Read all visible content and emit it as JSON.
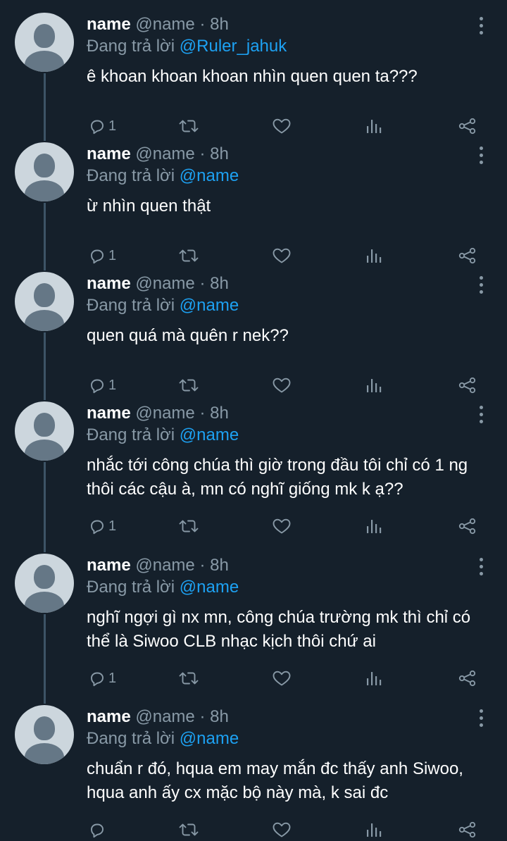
{
  "colors": {
    "background": "#15202b",
    "text": "#ffffff",
    "muted": "#8899a6",
    "accent": "#1da1f2"
  },
  "tweets": [
    {
      "name": "name",
      "handle": "@name",
      "dot": "·",
      "time": "8h",
      "reply_prefix": "Đang trả lời",
      "reply_to": "@Ruler_jahuk",
      "text": "ê khoan khoan khoan nhìn quen quen ta???",
      "reply_count": "1"
    },
    {
      "name": "name",
      "handle": "@name",
      "dot": "·",
      "time": "8h",
      "reply_prefix": "Đang trả lời",
      "reply_to": "@name",
      "text": "ừ nhìn quen thật",
      "reply_count": "1"
    },
    {
      "name": "name",
      "handle": "@name",
      "dot": "·",
      "time": "8h",
      "reply_prefix": "Đang trả lời",
      "reply_to": "@name",
      "text": "quen quá mà quên r nek??",
      "reply_count": "1"
    },
    {
      "name": "name",
      "handle": "@name",
      "dot": "·",
      "time": "8h",
      "reply_prefix": "Đang trả lời",
      "reply_to": "@name",
      "text": "nhắc tới công chúa thì giờ trong đầu tôi chỉ có 1 ng thôi các cậu à, mn có nghĩ giống mk k ạ??",
      "reply_count": "1"
    },
    {
      "name": "name",
      "handle": "@name",
      "dot": "·",
      "time": "8h",
      "reply_prefix": "Đang trả lời",
      "reply_to": "@name",
      "text": "nghĩ ngợi gì nx mn, công chúa trường mk thì chỉ có thể là Siwoo CLB nhạc kịch thôi chứ ai",
      "reply_count": "1"
    },
    {
      "name": "name",
      "handle": "@name",
      "dot": "·",
      "time": "8h",
      "reply_prefix": "Đang trả lời",
      "reply_to": "@name",
      "text": "chuẩn r đó, hqua em may mắn đc thấy anh Siwoo, hqua anh ấy cx mặc bộ này mà, k sai đc",
      "reply_count": ""
    }
  ],
  "icons": {
    "reply": "reply-icon",
    "retweet": "retweet-icon",
    "like": "heart-icon",
    "analytics": "analytics-icon",
    "share": "share-icon",
    "more": "more-vertical-icon"
  }
}
